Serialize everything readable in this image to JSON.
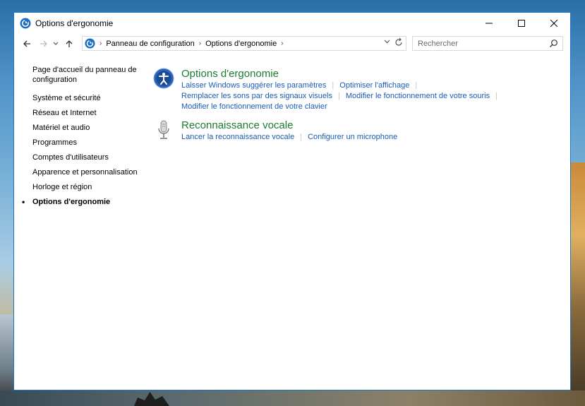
{
  "window": {
    "title": "Options d'ergonomie"
  },
  "address": {
    "crumbs": [
      "Panneau de configuration",
      "Options d'ergonomie"
    ]
  },
  "search": {
    "placeholder": "Rechercher"
  },
  "sidebar": {
    "home_label": "Page d'accueil du panneau de configuration",
    "items": [
      {
        "label": "Système et sécurité"
      },
      {
        "label": "Réseau et Internet"
      },
      {
        "label": "Matériel et audio"
      },
      {
        "label": "Programmes"
      },
      {
        "label": "Comptes d'utilisateurs"
      },
      {
        "label": "Apparence et personnalisation"
      },
      {
        "label": "Horloge et région"
      },
      {
        "label": "Options d'ergonomie"
      }
    ]
  },
  "content": {
    "ergonomie": {
      "title": "Options d'ergonomie",
      "links": [
        "Laisser Windows suggérer les paramètres",
        "Optimiser l'affichage",
        "Remplacer les sons par des signaux visuels",
        "Modifier le fonctionnement de votre souris",
        "Modifier le fonctionnement de votre clavier"
      ]
    },
    "voice": {
      "title": "Reconnaissance vocale",
      "links": [
        "Lancer la reconnaissance vocale",
        "Configurer un microphone"
      ]
    }
  },
  "colors": {
    "link": "#1a5bb5",
    "heading": "#1e7b34",
    "window_border": "#1a76c9"
  }
}
